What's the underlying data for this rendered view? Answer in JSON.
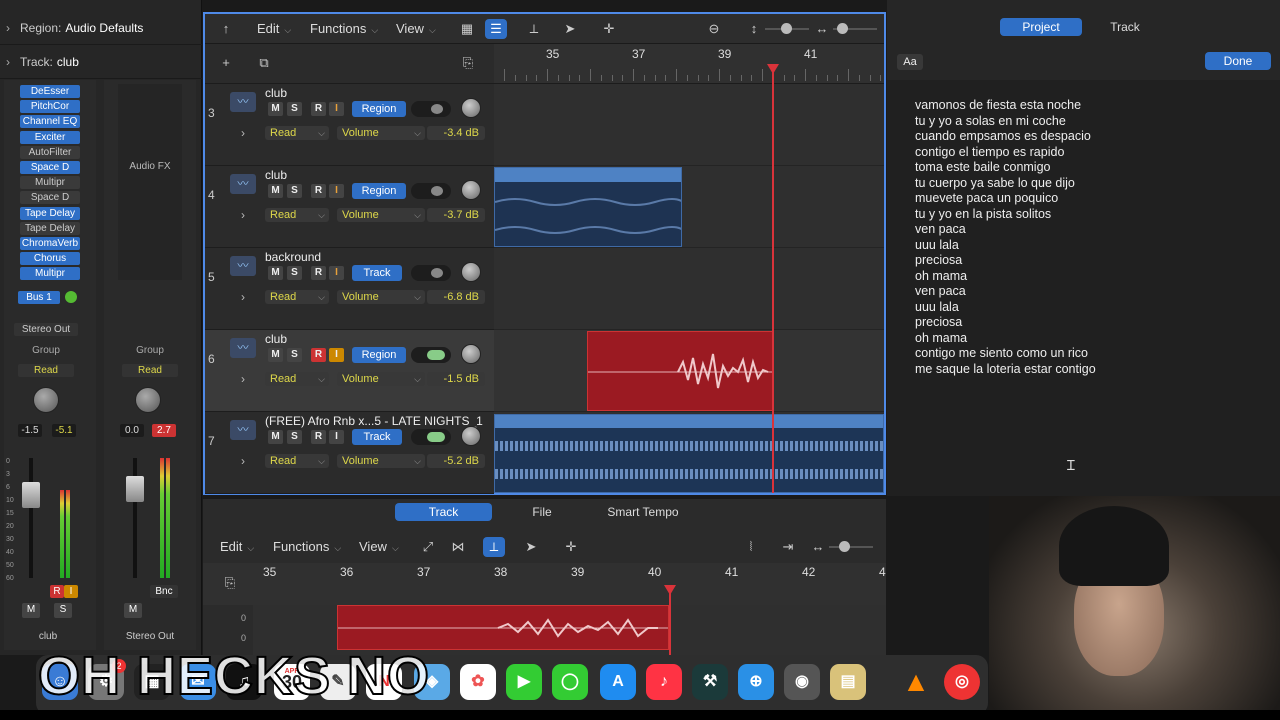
{
  "inspector": {
    "region_label": "Region:",
    "region_value": "Audio Defaults",
    "track_label": "Track:",
    "track_value": "club",
    "plugins": [
      "DeEsser",
      "PitchCor",
      "Channel EQ",
      "Exciter",
      "AutoFilter",
      "Space D",
      "Multipr",
      "Space D",
      "Tape Delay",
      "Tape Delay",
      "ChromaVerb",
      "Chorus",
      "Multipr"
    ],
    "audio_fx": "Audio FX",
    "bus": "Bus 1",
    "output": "Stereo Out",
    "group": "Group",
    "read": "Read",
    "left_vol": "-1.5",
    "left_peak": "-5.1",
    "right_vol": "0.0",
    "right_peak": "2.7",
    "btn_r": "R",
    "btn_i": "I",
    "btn_m": "M",
    "btn_s": "S",
    "bnc": "Bnc",
    "left_name": "club",
    "right_name": "Stereo Out",
    "fader_scale": [
      "0",
      "3",
      "6",
      "10",
      "15",
      "20",
      "30",
      "40",
      "50",
      "60"
    ]
  },
  "toolbar": {
    "edit": "Edit",
    "functions": "Functions",
    "view": "View"
  },
  "ruler": {
    "bars": [
      "35",
      "37",
      "39",
      "41"
    ]
  },
  "tracks": [
    {
      "num": "3",
      "name": "club",
      "tag": "Region",
      "read": "Read",
      "param": "Volume",
      "value": "-3.4 dB",
      "m": "M",
      "s": "S",
      "r": "R",
      "i": "I"
    },
    {
      "num": "4",
      "name": "club",
      "tag": "Region",
      "read": "Read",
      "param": "Volume",
      "value": "-3.7 dB",
      "m": "M",
      "s": "S",
      "r": "R",
      "i": "I"
    },
    {
      "num": "5",
      "name": "backround",
      "tag": "Track",
      "read": "Read",
      "param": "Volume",
      "value": "-6.8 dB",
      "m": "M",
      "s": "S",
      "r": "R",
      "i": "I"
    },
    {
      "num": "6",
      "name": "club",
      "tag": "Region",
      "read": "Read",
      "param": "Volume",
      "value": "-1.5 dB",
      "m": "M",
      "s": "S",
      "r": "R",
      "i": "I"
    },
    {
      "num": "7",
      "name": "(FREE) Afro Rnb x...5 - LATE NIGHTS_1",
      "tag": "Track",
      "read": "Read",
      "param": "Volume",
      "value": "-5.2 dB",
      "m": "M",
      "s": "S",
      "r": "R",
      "i": "I"
    }
  ],
  "editor": {
    "tabs": [
      "Track",
      "File",
      "Smart Tempo"
    ],
    "edit": "Edit",
    "functions": "Functions",
    "view": "View",
    "bars": [
      "35",
      "36",
      "37",
      "38",
      "39",
      "40",
      "41",
      "42",
      "4"
    ],
    "zero_a": "0",
    "zero_b": "0"
  },
  "rightpanel": {
    "tab_project": "Project",
    "tab_track": "Track",
    "aa": "Aa",
    "done": "Done",
    "lyrics": [
      "vamonos de fiesta esta noche",
      "tu y yo a solas en mi coche",
      "cuando empsamos es despacio",
      "contigo el tiempo es rapido",
      "toma este baile conmigo",
      "tu cuerpo ya sabe lo que dijo",
      "muevete paca un poquico",
      "tu y yo en la pista solitos",
      "ven paca",
      "uuu lala",
      "preciosa",
      "oh mama",
      "ven paca",
      "uuu lala",
      "preciosa",
      "oh mama",
      "contigo me siento como un rico",
      "me saque la loteria estar contigo"
    ]
  },
  "dock": {
    "calendar_month": "APR",
    "calendar_day": "30",
    "badge": "2",
    "overlay": "OH HECKS NO"
  },
  "colors": {
    "accent": "#2f6fc6",
    "playhead": "#d9333a",
    "region_red": "#9b1a22",
    "region_blue": "#2e5c97"
  }
}
